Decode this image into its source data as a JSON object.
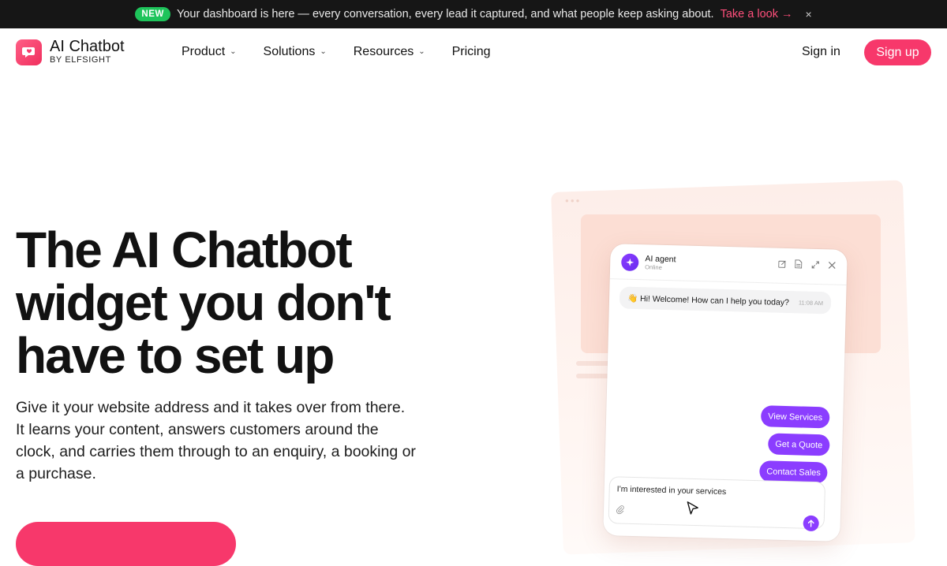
{
  "announcement": {
    "badge": "NEW",
    "text": "Your dashboard is here — every conversation, every lead it captured, and what people keep asking about.",
    "link": "Take a look",
    "close": "×"
  },
  "brand": {
    "name": "AI Chatbot",
    "byline": "BY ELFSIGHT",
    "accent": "#f7386b"
  },
  "nav": {
    "items": [
      {
        "label": "Product",
        "dropdown": true
      },
      {
        "label": "Solutions",
        "dropdown": true
      },
      {
        "label": "Resources",
        "dropdown": true
      },
      {
        "label": "Pricing",
        "dropdown": false
      }
    ],
    "signin": "Sign in",
    "signup": "Sign up"
  },
  "hero": {
    "title_lines": [
      "The AI Chatbot",
      "widget you don't",
      "have to set up"
    ],
    "subtitle_lines": [
      "Give it your website address and it takes over from there.",
      "It learns your content, answers customers around the",
      "clock, and carries them through to an enquiry, a booking or",
      "a purchase."
    ]
  },
  "chat_widget": {
    "agent_name": "AI agent",
    "agent_status": "Online",
    "welcome_message": "👋 Hi! Welcome! How can I help you today?",
    "welcome_time": "11:08 AM",
    "quick_replies": [
      "View Services",
      "Get a Quote",
      "Contact Sales"
    ],
    "composer_text": "I'm interested in your services",
    "accent": "#8b3dff"
  }
}
